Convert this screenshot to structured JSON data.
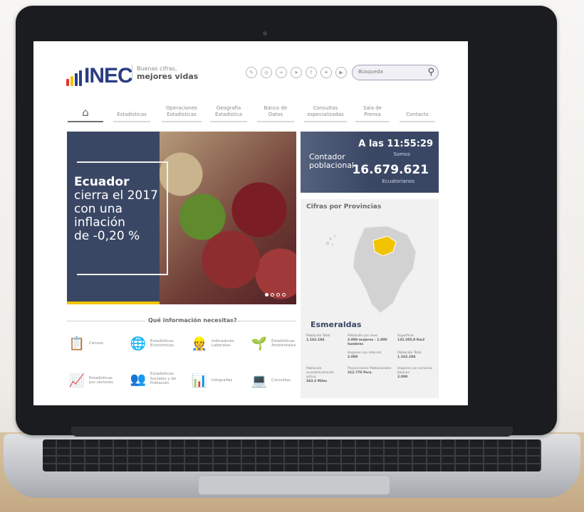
{
  "brand": {
    "name": "INEC",
    "tagline_1": "Buenas cifras,",
    "tagline_2": "mejores vidas",
    "bar_colors": [
      "#e7332d",
      "#f2c400",
      "#2b3d82",
      "#2b3d82",
      "#2b3d82"
    ]
  },
  "social_icons": [
    "blog-icon",
    "slideshare-icon",
    "flickr-icon",
    "telegram-icon",
    "facebook-icon",
    "twitter-icon",
    "youtube-icon"
  ],
  "search": {
    "placeholder": "Búsqueda"
  },
  "nav": {
    "home_icon": "home-icon",
    "items": [
      {
        "label": "Estadísticas"
      },
      {
        "label": "Operaciones\nEstadísticas"
      },
      {
        "label": "Geografía\nEstadística"
      },
      {
        "label": "Banco de\nDatos"
      },
      {
        "label": "Consultas\nespecializadas"
      },
      {
        "label": "Sala de\nPrensa"
      },
      {
        "label": "Contacto"
      }
    ]
  },
  "hero": {
    "line1": "Ecuador",
    "line2": "cierra el 2017",
    "line3": "con una",
    "line4": "inflación",
    "line5": "de -0,20 %",
    "slides": 4,
    "active_slide": 0,
    "accent": "#f2c400"
  },
  "counter": {
    "label_1": "Contador",
    "label_2": "poblacional",
    "time": "A las 11:55:29",
    "somos": "Somos",
    "number": "16.679.621",
    "unit": "Ecuatorianos"
  },
  "provincias": {
    "title": "Cifras por Provincias",
    "selected": "Esmeraldas",
    "highlight_color": "#f2c400",
    "stats": {
      "pob_total_label": "Población Total",
      "pob_total_value": "1.162.194",
      "pob_sexo_label": "Población por sexo",
      "pob_sexo_value": "2.000 mujeres - 1.000 hombres",
      "superficie_label": "Superficie",
      "superficie_value": "132.205,9 Km2",
      "hogares_internet_label": "Hogares con internet",
      "hogares_internet_value": "2.000",
      "pob_total2_label": "Población Total",
      "pob_total2_value": "1.162.194",
      "pea_label": "Población económicamente activa",
      "pea_value": "263.2 Miles",
      "proyecciones_label": "Proyecciones Poblacionales",
      "proyecciones_value": "312.770 Pers.",
      "hogares_servicios_label": "Hogares con servicios básicos",
      "hogares_servicios_value": "2.000"
    }
  },
  "info": {
    "title": "Qué información necesitas?",
    "categories": [
      {
        "label": "Censos",
        "icon": "clipboard-icon"
      },
      {
        "label": "Estadísticas\nEconómicas",
        "icon": "globe-money-icon"
      },
      {
        "label": "Indicadores\nLaborales",
        "icon": "worker-icon"
      },
      {
        "label": "Estadísticas\nAmbientales",
        "icon": "plant-hand-icon"
      },
      {
        "label": "Estadísticas\npor sectores",
        "icon": "growth-chart-icon"
      },
      {
        "label": "Estadísticas\nSociales y de\nPoblación",
        "icon": "people-icon"
      },
      {
        "label": "Infografías",
        "icon": "presentation-icon"
      },
      {
        "label": "Consultas",
        "icon": "computer-user-icon"
      }
    ]
  }
}
